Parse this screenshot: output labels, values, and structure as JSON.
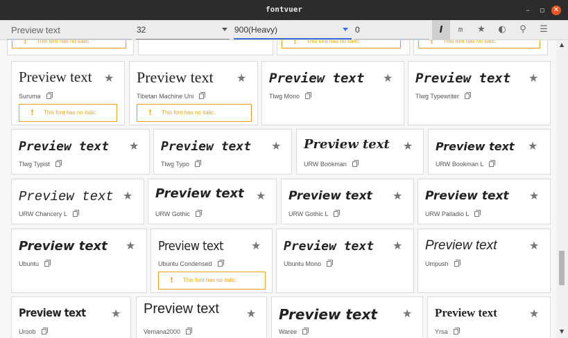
{
  "window": {
    "title": "fontvuer"
  },
  "toolbar": {
    "preview_text": "Preview text",
    "size": "32",
    "weight": "900(Heavy)",
    "spacing": "0"
  },
  "warning_text": "This font has no italic.",
  "preview": "Preview text",
  "fonts": [
    {
      "name": "Suruma",
      "warn": true
    },
    {
      "name": "Tibetan Machine Uni",
      "warn": true
    },
    {
      "name": "Tlwg Mono",
      "warn": false
    },
    {
      "name": "Tlwg Typewriter",
      "warn": false
    },
    {
      "name": "Tlwg Typist",
      "warn": false
    },
    {
      "name": "Tlwg Typo",
      "warn": false
    },
    {
      "name": "URW Bookman",
      "warn": false
    },
    {
      "name": "URW Bookman L",
      "warn": false
    },
    {
      "name": "URW Chancery L",
      "warn": false
    },
    {
      "name": "URW Gothic",
      "warn": false
    },
    {
      "name": "URW Gothic L",
      "warn": false
    },
    {
      "name": "URW Palladio L",
      "warn": false
    },
    {
      "name": "Ubuntu",
      "warn": false
    },
    {
      "name": "Ubuntu Condensed",
      "warn": true
    },
    {
      "name": "Ubuntu Mono",
      "warn": false
    },
    {
      "name": "Umpush",
      "warn": false
    },
    {
      "name": "Uroob",
      "warn": false
    },
    {
      "name": "Vemana2000",
      "warn": false
    },
    {
      "name": "Waree",
      "warn": false
    },
    {
      "name": "Yrsa",
      "warn": false
    }
  ]
}
